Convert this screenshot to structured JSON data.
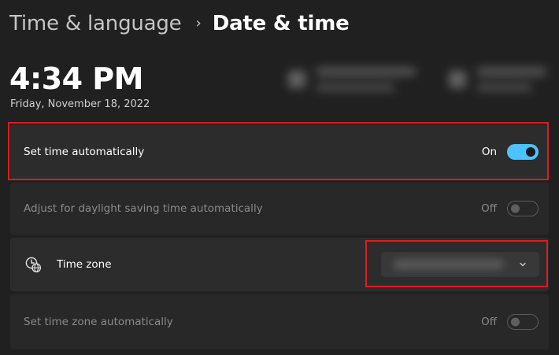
{
  "breadcrumb": {
    "parent": "Time & language",
    "separator": "›",
    "current": "Date & time"
  },
  "clock": {
    "time": "4:34 PM",
    "date": "Friday, November 18, 2022"
  },
  "settings": {
    "set_time_auto": {
      "label": "Set time automatically",
      "state_text": "On",
      "enabled": true
    },
    "daylight_saving": {
      "label": "Adjust for daylight saving time automatically",
      "state_text": "Off",
      "enabled": false
    },
    "time_zone": {
      "label": "Time zone",
      "icon": "clock-globe-icon"
    },
    "set_tz_auto": {
      "label": "Set time zone automatically",
      "state_text": "Off",
      "enabled": false
    }
  },
  "colors": {
    "background": "#202020",
    "card": "#2c2c2c",
    "accent": "#4cc2ff",
    "highlight": "#e01b1b"
  }
}
